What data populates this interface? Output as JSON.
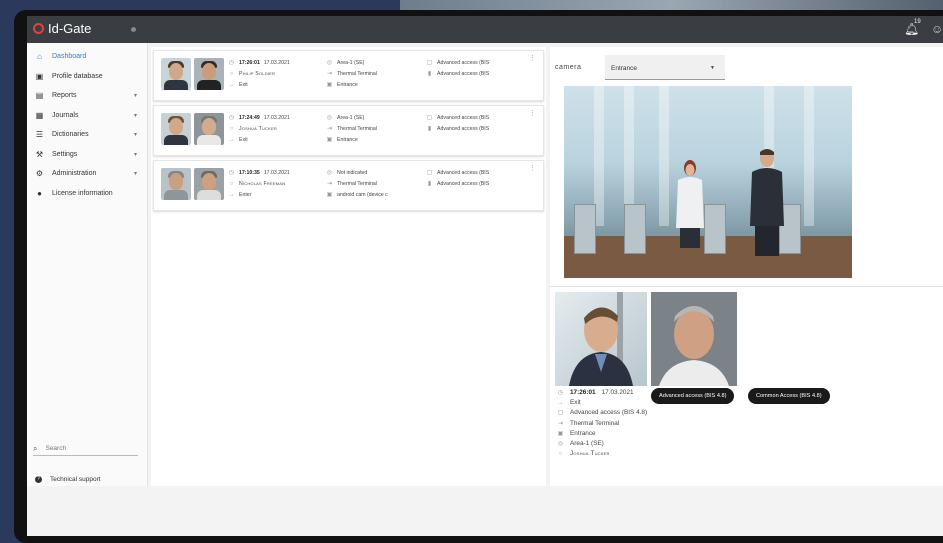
{
  "app": {
    "title": "Id-Gate",
    "notification_badge": "19"
  },
  "sidebar": {
    "items": [
      {
        "label": "Dashboard",
        "icon": "home-icon",
        "active": true,
        "has_caret": false
      },
      {
        "label": "Profile database",
        "icon": "id-card-icon",
        "active": false,
        "has_caret": false
      },
      {
        "label": "Reports",
        "icon": "report-icon",
        "active": false,
        "has_caret": true
      },
      {
        "label": "Journals",
        "icon": "journal-icon",
        "active": false,
        "has_caret": true
      },
      {
        "label": "Dictionaries",
        "icon": "list-icon",
        "active": false,
        "has_caret": true
      },
      {
        "label": "Settings",
        "icon": "wrench-icon",
        "active": false,
        "has_caret": true
      },
      {
        "label": "Administration",
        "icon": "gear-icon",
        "active": false,
        "has_caret": true
      },
      {
        "label": "License information",
        "icon": "license-icon",
        "active": false,
        "has_caret": false
      }
    ],
    "search_placeholder": "Search",
    "support_label": "Technical support"
  },
  "events": [
    {
      "time": "17:26:01",
      "date": "17.03.2021",
      "person": "Philip Soldier",
      "direction": "Exit",
      "zone": "Area-1 (SE)",
      "device": "Thermal Terminal",
      "point": "Entrance",
      "access1": "Advanced access (BIS",
      "access2": "Advanced access (BIS"
    },
    {
      "time": "17:24:49",
      "date": "17.03.2021",
      "person": "Joshua Tucker",
      "direction": "Exit",
      "zone": "Area-1 (SE)",
      "device": "Thermal Terminal",
      "point": "Entrance",
      "access1": "Advanced access (BIS",
      "access2": "Advanced access (BIS"
    },
    {
      "time": "17:10:35",
      "date": "17.03.2021",
      "person": "Nicholas Freeman",
      "direction": "Enter",
      "zone": "Not indicated",
      "device": "Thermal Terminal",
      "point": "android cam (device c",
      "access1": "Advanced access (BIS",
      "access2": "Advanced access (BIS"
    }
  ],
  "camera": {
    "label": "camera",
    "selected": "Entrance"
  },
  "detail": {
    "time": "17:26:01",
    "date": "17.03.2021",
    "direction": "Exit",
    "access": "Advanced access (BIS 4.8)",
    "device": "Thermal Terminal",
    "point": "Entrance",
    "zone": "Area-1 (SE)",
    "person": "Joshua Tucker",
    "chips": [
      "Advanced access (BIS 4.8)",
      "Common Access (BIS 4.8)"
    ]
  }
}
